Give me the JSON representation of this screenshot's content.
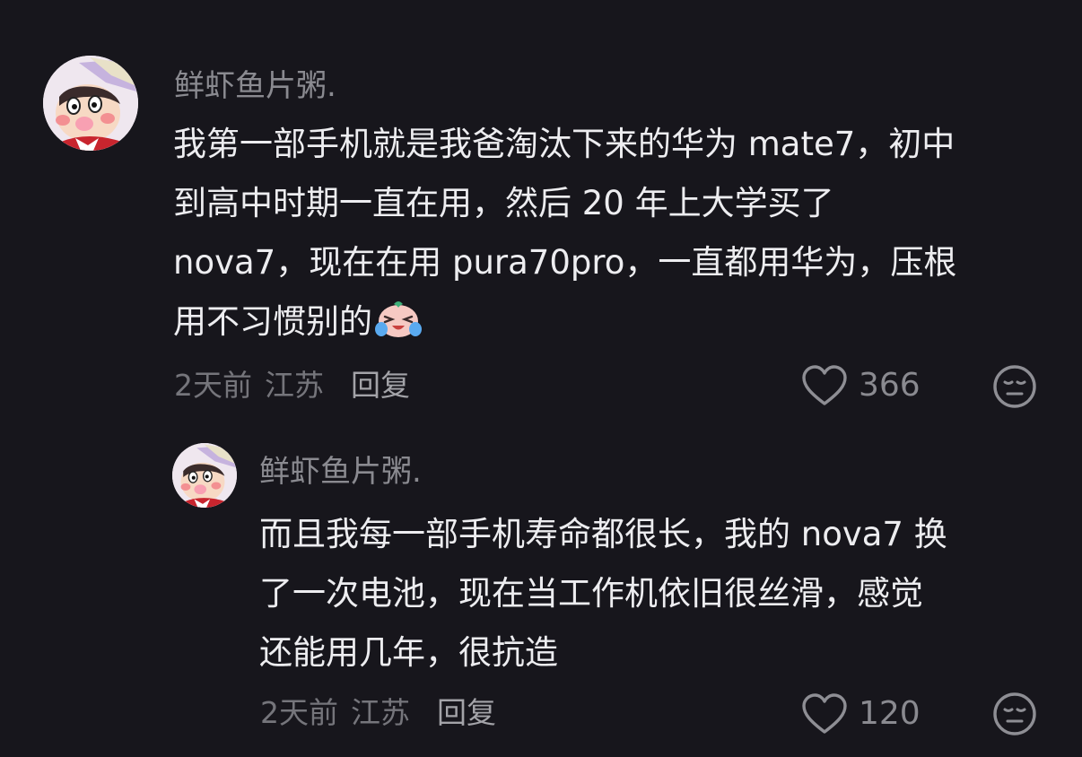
{
  "comments": [
    {
      "username": "鲜虾鱼片粥.",
      "lines": [
        "我第一部手机就是我爸淘汰下来的华为 mate7，初中",
        "到高中时期一直在用，然后 20 年上大学买了",
        " nova7，现在在用 pura70pro，一直都用华为，压根",
        "用不习惯别的"
      ],
      "emoji": "crying-laughing-emoji",
      "time": "2天前",
      "location": "江苏",
      "reply_label": "回复",
      "likes": "366"
    },
    {
      "username": "鲜虾鱼片粥.",
      "lines": [
        "而且我每一部手机寿命都很长，我的 nova7 换",
        "了一次电池，现在当工作机依旧很丝滑，感觉",
        "还能用几年，很抗造"
      ],
      "time": "2天前",
      "location": "江苏",
      "reply_label": "回复",
      "likes": "120"
    }
  ],
  "colors": {
    "background": "#17161c",
    "username": "#8a8a90",
    "body": "#ededf0",
    "meta": "#75757b"
  },
  "icons": [
    "avatar",
    "heart-icon",
    "dislike-face-icon",
    "crying-laughing-emoji"
  ]
}
